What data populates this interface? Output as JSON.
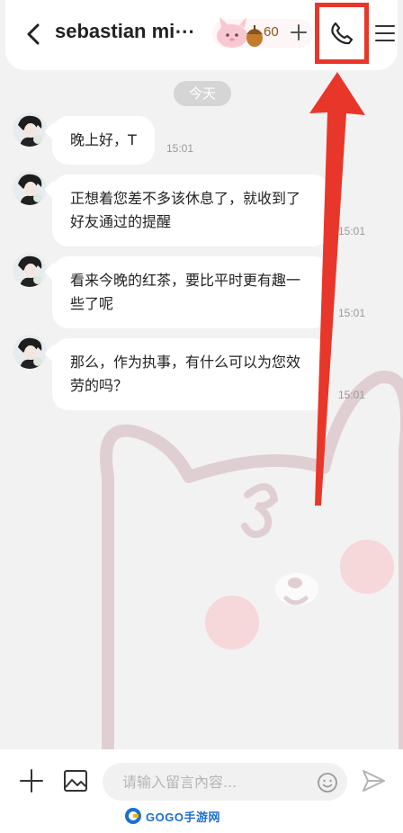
{
  "header": {
    "title": "sebastian mi⋯",
    "coin_count": "60",
    "icons": {
      "back": "chevron-left-icon",
      "plus": "plus-icon",
      "call": "phone-icon",
      "menu": "hamburger-menu-icon"
    }
  },
  "chat": {
    "date_label": "今天",
    "messages": [
      {
        "text": "晚上好，T",
        "time": "15:01"
      },
      {
        "text": "正想着您差不多该休息了，就收到了好友通过的提醒",
        "time": "15:01"
      },
      {
        "text": "看来今晚的红茶，要比平时更有趣一些了呢",
        "time": "15:01"
      },
      {
        "text": "那么，作为执事，有什么可以为您效劳的吗？",
        "time": "15:01"
      }
    ]
  },
  "composer": {
    "placeholder": "请输入留言內容...",
    "icons": {
      "add": "plus-icon",
      "image": "image-icon",
      "emoji": "smiley-icon",
      "send": "send-icon"
    }
  },
  "watermark": {
    "text": "GOGO手游网"
  },
  "colors": {
    "annotation_red": "#e8372a",
    "background": "#f2f2f2",
    "bubble": "#ffffff",
    "coin_text": "#8a5a1a"
  }
}
